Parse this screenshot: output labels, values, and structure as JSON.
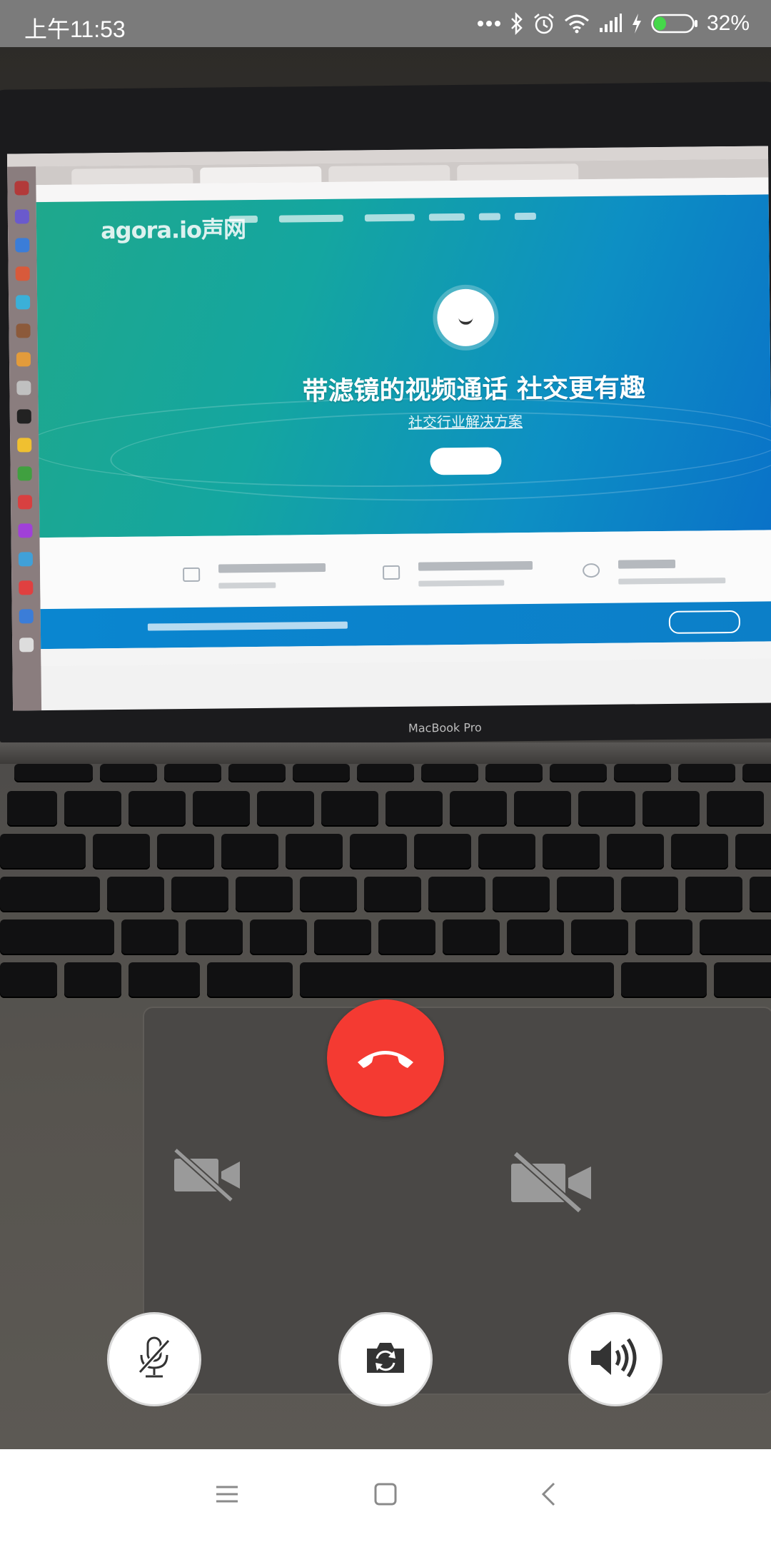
{
  "status_bar": {
    "time": "上午11:53",
    "battery_percent": "32%",
    "battery_level": 0.32,
    "icons": [
      "more-dots-icon",
      "bluetooth-icon",
      "alarm-icon",
      "wifi-icon",
      "signal-icon",
      "charging-icon",
      "battery-icon"
    ]
  },
  "video_feed": {
    "website_title": "带滤镜的视频通话  社交更有趣",
    "website_subtitle": "社交行业解决方案",
    "website_logo": "agora.io声网",
    "laptop_label": "MacBook Pro"
  },
  "call_controls": {
    "end_call": "end-call-icon",
    "remote_video_state": "camera-off-icon",
    "local_video_state": "camera-off-icon",
    "buttons": [
      {
        "name": "mute",
        "icon": "microphone-muted-icon"
      },
      {
        "name": "switch-camera",
        "icon": "camera-switch-icon"
      },
      {
        "name": "speaker",
        "icon": "speaker-icon"
      }
    ]
  },
  "nav_bar": {
    "buttons": [
      "menu-icon",
      "home-icon",
      "back-icon"
    ]
  },
  "colors": {
    "end_call": "#f43a32",
    "status_bar": "#7b7b7b",
    "battery_fill": "#45d84a",
    "nav_bar": "#ffffff"
  }
}
